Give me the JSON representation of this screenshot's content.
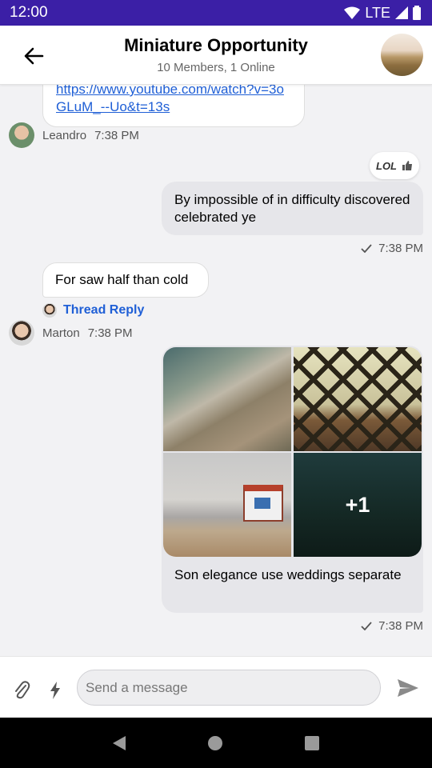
{
  "status": {
    "time": "12:00",
    "network": "LTE"
  },
  "header": {
    "title": "Miniature Opportunity",
    "subtitle": "10 Members, 1 Online"
  },
  "messages": {
    "link_text": "https://www.youtube.com/watch?v=3oGLuM_--Uo&t=13s",
    "leandro": {
      "name": "Leandro",
      "time": "7:38 PM"
    },
    "reaction_label": "LOL",
    "my_text1": "By impossible of in difficulty discovered celebrated ye",
    "my_time1": "7:38 PM",
    "their_text": "For saw half than cold",
    "thread_reply": "Thread Reply",
    "marton": {
      "name": "Marton",
      "time": "7:38 PM"
    },
    "gallery_more": "+1",
    "gallery_caption": "Son elegance use weddings separate",
    "my_time2": "7:38 PM"
  },
  "composer": {
    "placeholder": "Send a message"
  }
}
